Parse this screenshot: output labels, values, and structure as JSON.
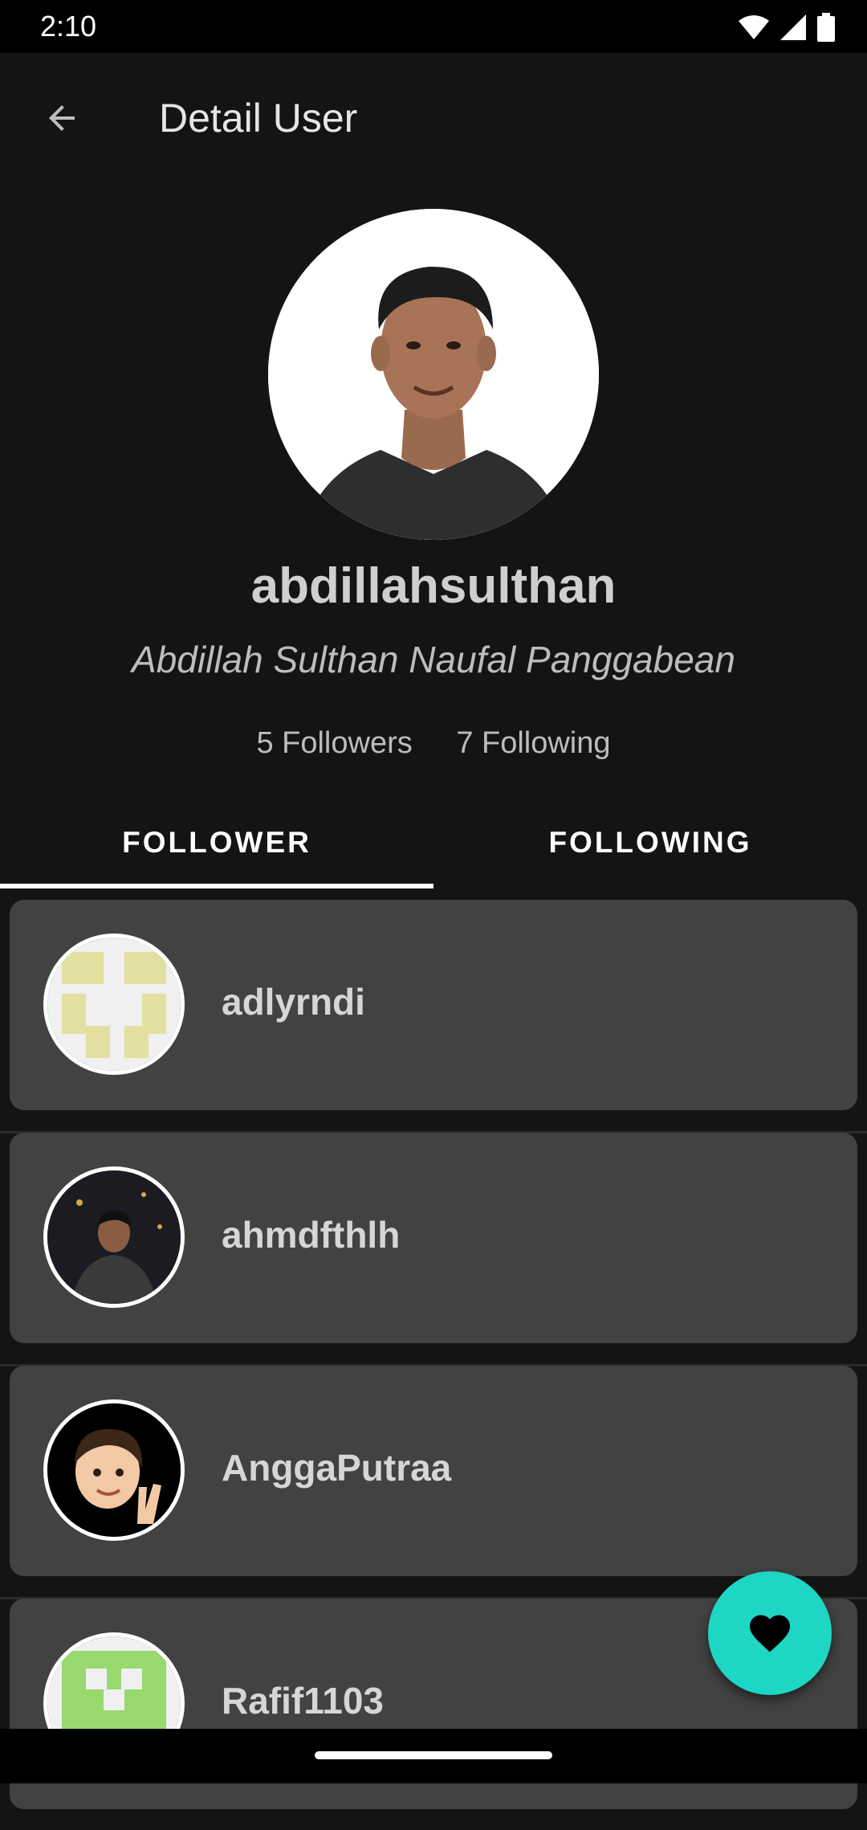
{
  "status_bar": {
    "time": "2:10",
    "icons": [
      "wifi-icon",
      "signal-icon",
      "battery-icon"
    ]
  },
  "app_bar": {
    "title": "Detail User",
    "back_icon": "arrow-back-icon"
  },
  "profile": {
    "username": "abdillahsulthan",
    "full_name": "Abdillah Sulthan Naufal Panggabean",
    "followers": "5 Followers",
    "following": "7 Following"
  },
  "tabs": [
    {
      "label": "FOLLOWER",
      "selected": true
    },
    {
      "label": "FOLLOWING",
      "selected": false
    }
  ],
  "list": [
    {
      "username": "adlyrndi"
    },
    {
      "username": "ahmdfthlh"
    },
    {
      "username": "AnggaPutraa"
    },
    {
      "username": "Rafif1103"
    }
  ],
  "fab": {
    "icon": "heart-icon"
  },
  "colors": {
    "accent": "#1ed6c4",
    "background": "#141414",
    "card": "#424242"
  }
}
